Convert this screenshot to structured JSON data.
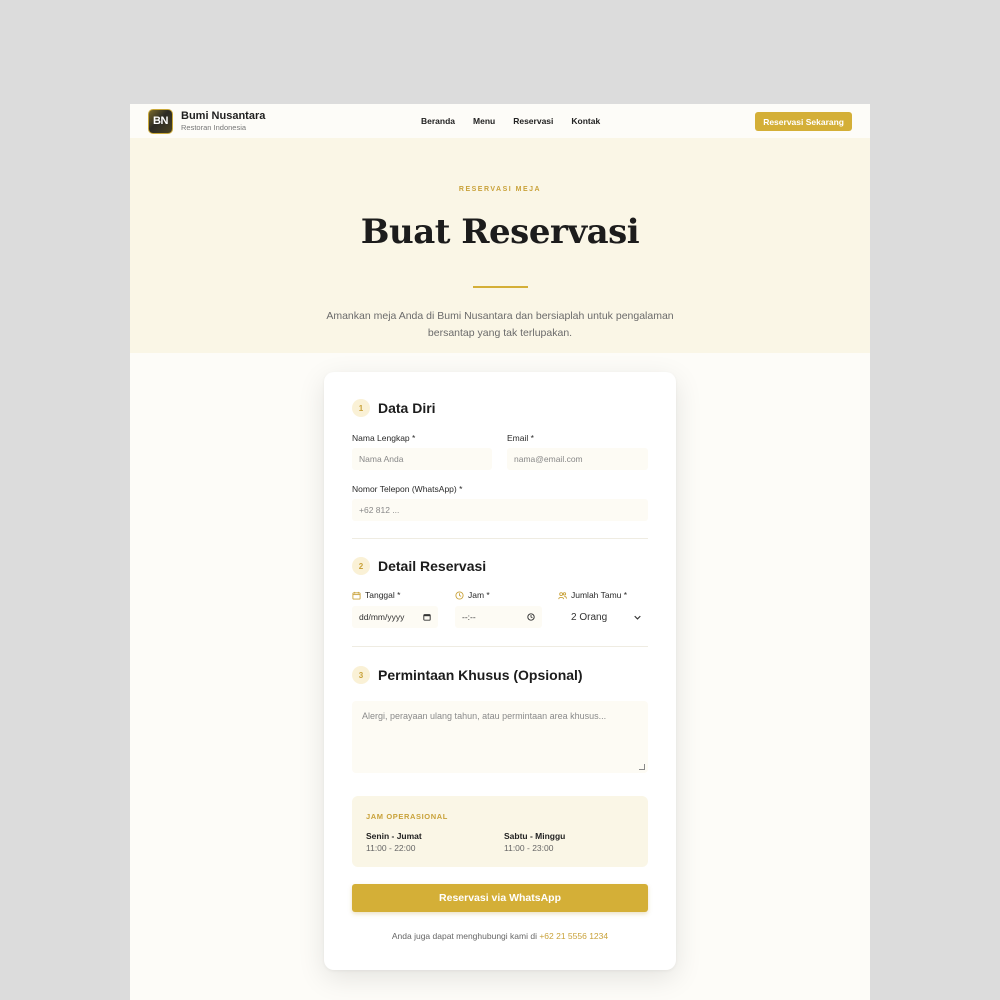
{
  "brand": {
    "logo": "BN",
    "name": "Bumi Nusantara",
    "subtitle": "Restoran Indonesia"
  },
  "nav": {
    "items": [
      "Beranda",
      "Menu",
      "Reservasi",
      "Kontak"
    ],
    "cta": "Reservasi Sekarang"
  },
  "hero": {
    "eyebrow": "RESERVASI MEJA",
    "title": "Buat Reservasi",
    "description": "Amankan meja Anda di Bumi Nusantara dan bersiaplah untuk pengalaman bersantap yang tak terlupakan."
  },
  "form": {
    "section1": {
      "number": "1",
      "title": "Data Diri",
      "name_label": "Nama Lengkap *",
      "name_placeholder": "Nama Anda",
      "email_label": "Email *",
      "email_placeholder": "nama@email.com",
      "phone_label": "Nomor Telepon (WhatsApp) *",
      "phone_placeholder": "+62 812 ..."
    },
    "section2": {
      "number": "2",
      "title": "Detail Reservasi",
      "date_label": "Tanggal *",
      "date_value": "dd/mm/yyyy",
      "time_label": "Jam *",
      "time_value": "--:--",
      "guests_label": "Jumlah Tamu *",
      "guests_value": "2 Orang"
    },
    "section3": {
      "number": "3",
      "title": "Permintaan Khusus (Opsional)",
      "placeholder": "Alergi, perayaan ulang tahun, atau permintaan area khusus..."
    },
    "hours": {
      "title": "JAM OPERASIONAL",
      "weekday": {
        "day": "Senin - Jumat",
        "time": "11:00 - 22:00"
      },
      "weekend": {
        "day": "Sabtu - Minggu",
        "time": "11:00 - 23:00"
      }
    },
    "submit": "Reservasi via WhatsApp",
    "contact_prefix": "Anda juga dapat menghubungi kami di",
    "contact_phone": "+62 21 5556 1234"
  },
  "colors": {
    "accent": "#d4af37",
    "hero_bg": "#faf6e6",
    "page_bg": "#fdfcf8"
  }
}
